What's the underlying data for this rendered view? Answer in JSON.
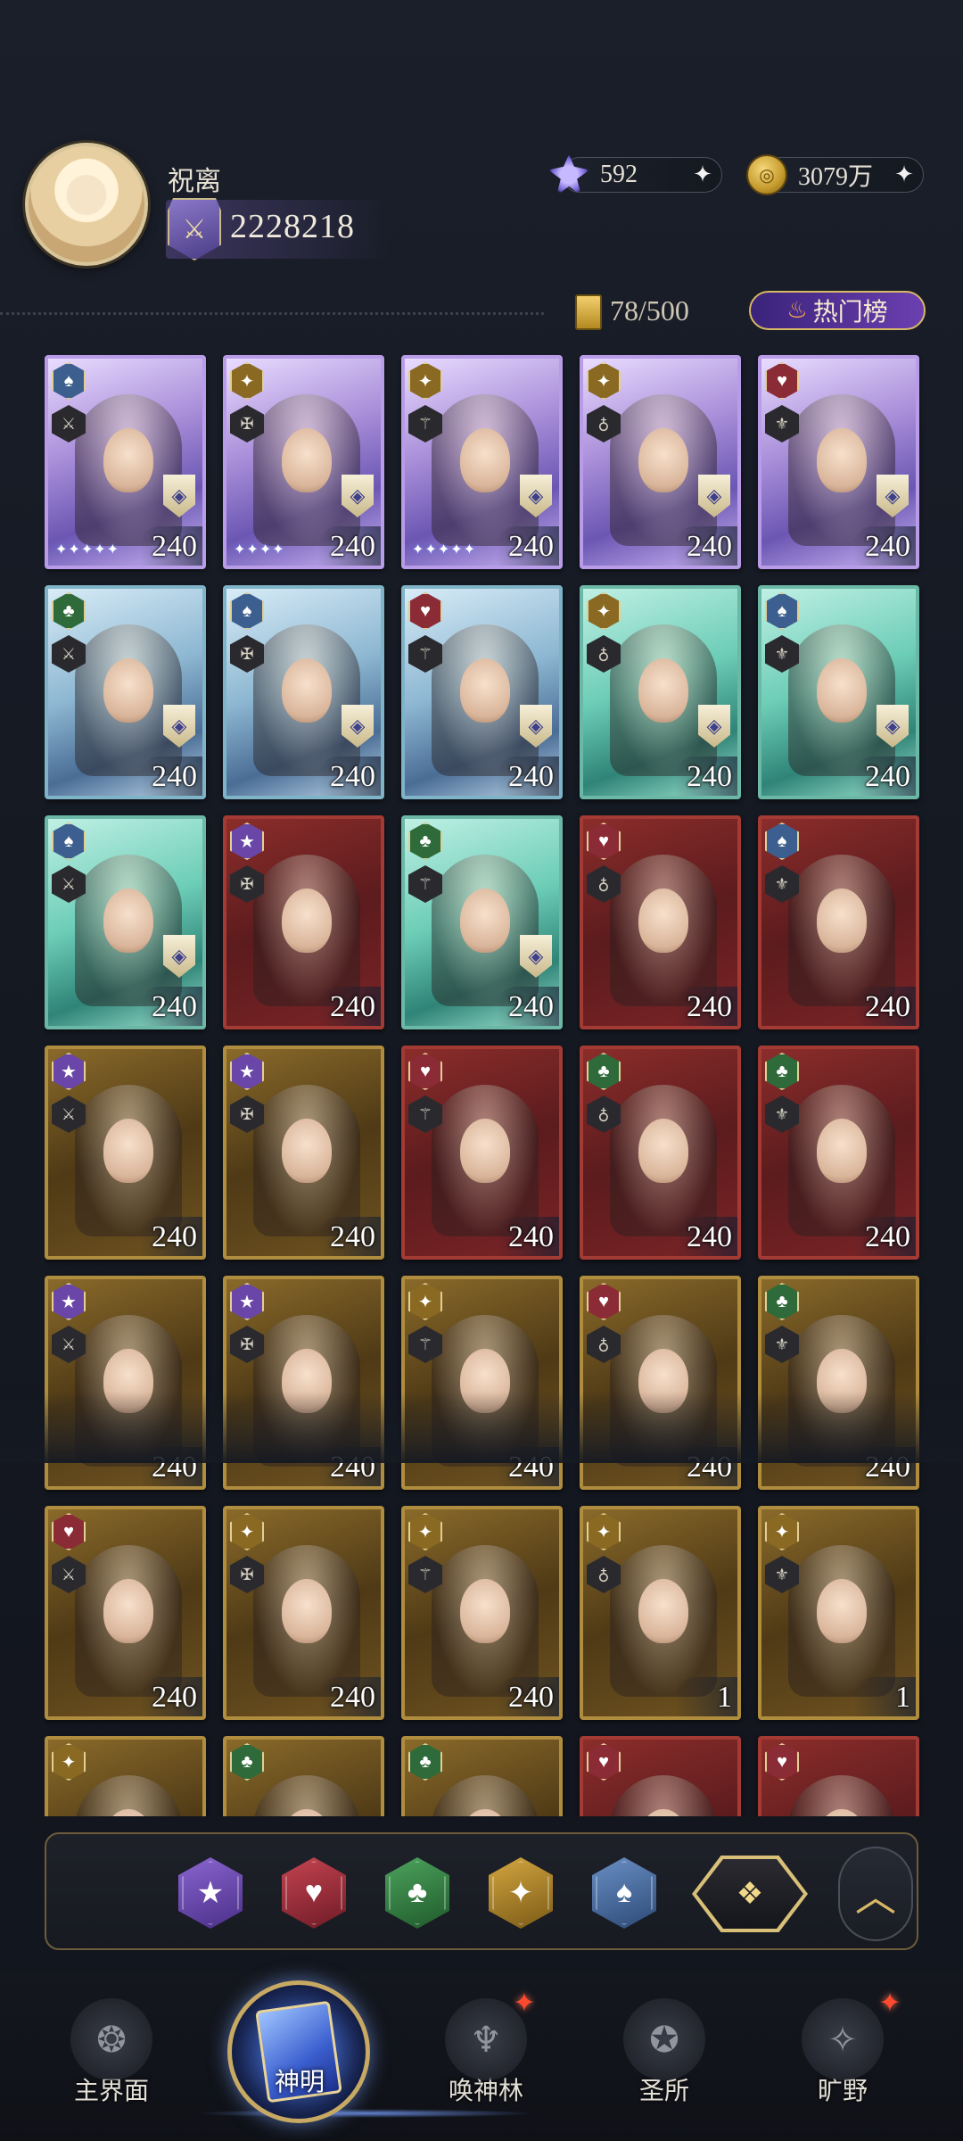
{
  "header": {
    "username": "祝离",
    "power": "2228218",
    "crystals": "592",
    "gold": "3079万",
    "card_count": "78/500",
    "hot_rank_label": "热门榜"
  },
  "icons": {
    "crystal": "crystal-icon",
    "coin": "coin-icon",
    "plus": "plus-icon",
    "flame": "flame-icon"
  },
  "cards": [
    {
      "faction": "spade",
      "rarity": "purple",
      "level": "240",
      "stars": "✦✦✦✦✦",
      "tier": true
    },
    {
      "faction": "sun",
      "rarity": "purple",
      "level": "240",
      "stars": "✦✦✦✦",
      "tier": true
    },
    {
      "faction": "sun",
      "rarity": "purple",
      "level": "240",
      "stars": "✦✦✦✦✦",
      "tier": true
    },
    {
      "faction": "sun",
      "rarity": "purple",
      "level": "240",
      "stars": "",
      "tier": true
    },
    {
      "faction": "heart",
      "rarity": "purple",
      "level": "240",
      "stars": "",
      "tier": true
    },
    {
      "faction": "club",
      "rarity": "blue",
      "level": "240",
      "stars": "",
      "tier": true
    },
    {
      "faction": "spade",
      "rarity": "blue",
      "level": "240",
      "stars": "",
      "tier": true
    },
    {
      "faction": "heart",
      "rarity": "blue",
      "level": "240",
      "stars": "",
      "tier": true
    },
    {
      "faction": "sun",
      "rarity": "teal",
      "level": "240",
      "stars": "",
      "tier": true
    },
    {
      "faction": "spade",
      "rarity": "teal",
      "level": "240",
      "stars": "",
      "tier": true
    },
    {
      "faction": "spade",
      "rarity": "teal",
      "level": "240",
      "stars": "",
      "tier": true
    },
    {
      "faction": "star",
      "rarity": "red",
      "level": "240",
      "stars": "",
      "tier": false
    },
    {
      "faction": "club",
      "rarity": "teal",
      "level": "240",
      "stars": "",
      "tier": true
    },
    {
      "faction": "heart",
      "rarity": "red",
      "level": "240",
      "stars": "",
      "tier": false
    },
    {
      "faction": "spade",
      "rarity": "red",
      "level": "240",
      "stars": "",
      "tier": false
    },
    {
      "faction": "star",
      "rarity": "gold",
      "level": "240",
      "stars": "",
      "tier": false
    },
    {
      "faction": "star",
      "rarity": "gold",
      "level": "240",
      "stars": "",
      "tier": false
    },
    {
      "faction": "heart",
      "rarity": "red",
      "level": "240",
      "stars": "",
      "tier": false
    },
    {
      "faction": "club",
      "rarity": "red",
      "level": "240",
      "stars": "",
      "tier": false
    },
    {
      "faction": "club",
      "rarity": "red",
      "level": "240",
      "stars": "",
      "tier": false
    },
    {
      "faction": "star",
      "rarity": "gold",
      "level": "240",
      "stars": "",
      "tier": false
    },
    {
      "faction": "star",
      "rarity": "gold",
      "level": "240",
      "stars": "",
      "tier": false
    },
    {
      "faction": "sun",
      "rarity": "gold",
      "level": "240",
      "stars": "",
      "tier": false
    },
    {
      "faction": "heart",
      "rarity": "gold",
      "level": "240",
      "stars": "",
      "tier": false
    },
    {
      "faction": "club",
      "rarity": "gold",
      "level": "240",
      "stars": "",
      "tier": false
    },
    {
      "faction": "heart",
      "rarity": "gold",
      "level": "240",
      "stars": "",
      "tier": false
    },
    {
      "faction": "sun",
      "rarity": "gold",
      "level": "240",
      "stars": "",
      "tier": false
    },
    {
      "faction": "sun",
      "rarity": "gold",
      "level": "240",
      "stars": "",
      "tier": false
    },
    {
      "faction": "sun",
      "rarity": "gold",
      "level": "1",
      "stars": "",
      "tier": false
    },
    {
      "faction": "sun",
      "rarity": "gold",
      "level": "1",
      "stars": "",
      "tier": false
    },
    {
      "faction": "sun",
      "rarity": "gold",
      "level": "",
      "stars": "",
      "tier": false
    },
    {
      "faction": "club",
      "rarity": "gold",
      "level": "",
      "stars": "",
      "tier": false
    },
    {
      "faction": "club",
      "rarity": "gold",
      "level": "",
      "stars": "",
      "tier": false
    },
    {
      "faction": "heart",
      "rarity": "red",
      "level": "",
      "stars": "",
      "tier": false
    },
    {
      "faction": "heart",
      "rarity": "red",
      "level": "",
      "stars": "",
      "tier": false
    }
  ],
  "filters": [
    {
      "name": "star",
      "icon": "star-icon"
    },
    {
      "name": "heart",
      "icon": "heart-icon"
    },
    {
      "name": "club",
      "icon": "club-icon"
    },
    {
      "name": "sun",
      "icon": "sun-icon"
    },
    {
      "name": "spade",
      "icon": "spade-icon"
    },
    {
      "name": "all",
      "icon": "all-factions-icon"
    }
  ],
  "nav": {
    "main_world": "主界面",
    "gods": "神明",
    "summon_forest": "唤神林",
    "sanctuary": "圣所",
    "wilds": "旷野"
  },
  "colors": {
    "accent_gold": "#d8b866",
    "notify_red": "#ff4a2f",
    "hot_rank_purple": "#6b3fb0"
  }
}
